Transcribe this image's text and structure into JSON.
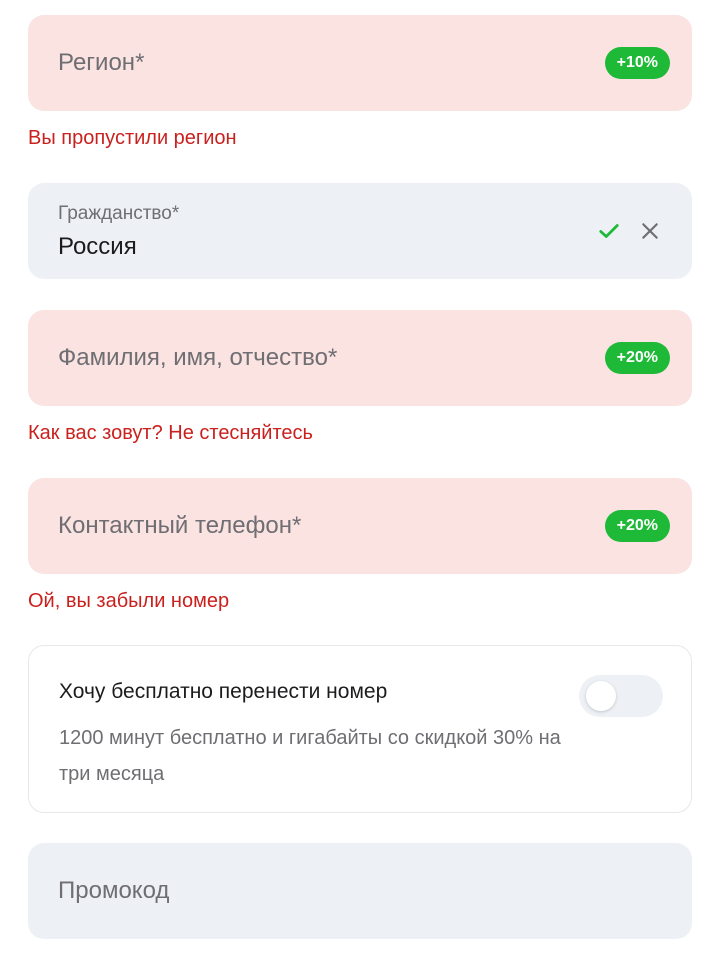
{
  "region": {
    "placeholder": "Регион*",
    "badge": "+10%",
    "error": "Вы пропустили регион"
  },
  "citizenship": {
    "label": "Гражданство*",
    "value": "Россия",
    "valid_icon": "check-icon",
    "clear_icon": "close-icon"
  },
  "full_name": {
    "placeholder": "Фамилия, имя, отчество*",
    "badge": "+20%",
    "error": "Как вас зовут? Не стесняйтесь"
  },
  "phone": {
    "placeholder": "Контактный телефон*",
    "badge": "+20%",
    "error": "Ой, вы забыли номер"
  },
  "port_number": {
    "title": "Хочу бесплатно перенести номер",
    "description": "1200 минут бесплатно и гигабайты со скидкой 30% на три месяца",
    "enabled": false
  },
  "promo": {
    "placeholder": "Промокод"
  },
  "colors": {
    "error_bg": "#fbe3e2",
    "neutral_bg": "#edf1f5",
    "badge_green": "#1db937",
    "error_text": "#c9211e",
    "check_green": "#1db937"
  }
}
